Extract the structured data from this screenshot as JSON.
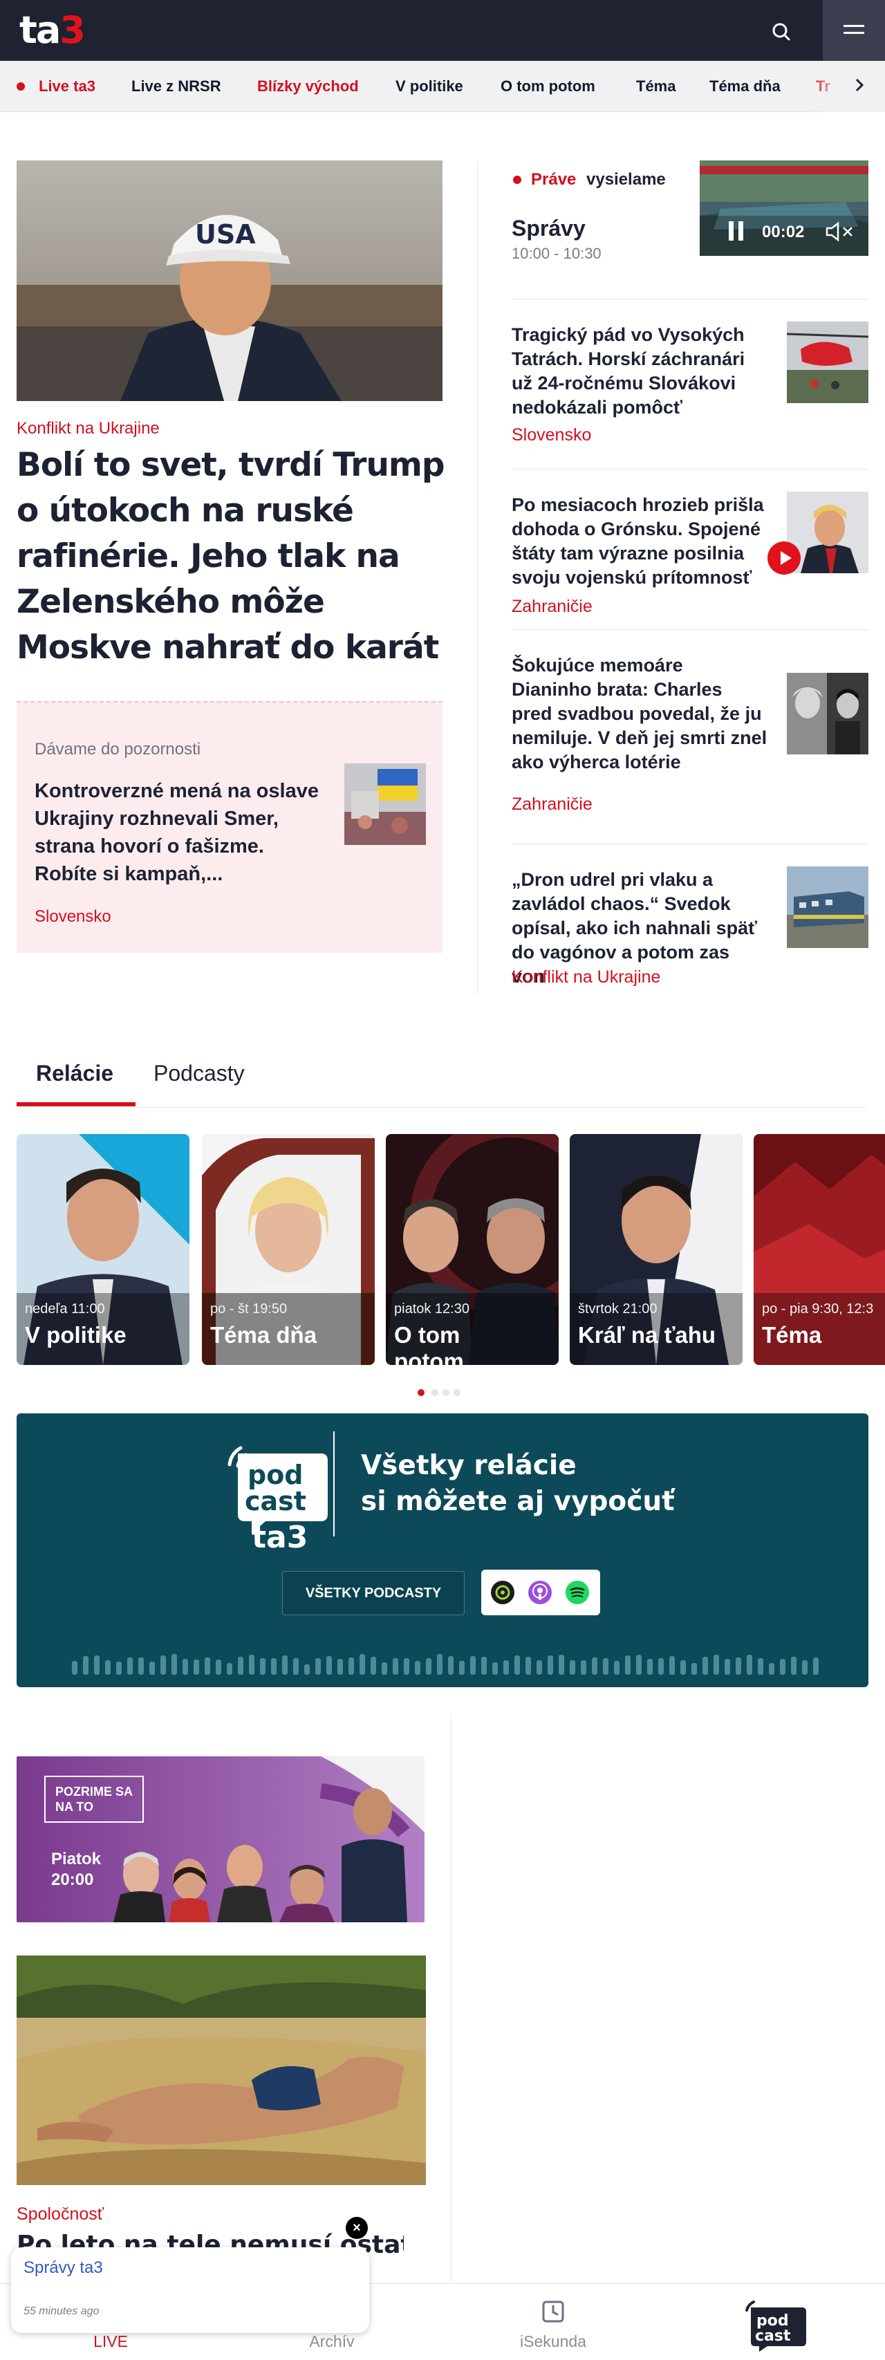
{
  "header": {
    "logo_main": "ta",
    "logo_accent": "3",
    "search_icon": "search-icon",
    "menu_icon": "hamburger-icon"
  },
  "nav": {
    "items": [
      {
        "label": "Live ta3",
        "highlight": true
      },
      {
        "label": "Live z NRSR",
        "highlight": false
      },
      {
        "label": "Blízky východ",
        "highlight": true
      },
      {
        "label": "V politike",
        "highlight": false
      },
      {
        "label": "O tom potom",
        "highlight": false
      },
      {
        "label": "Téma",
        "highlight": false
      },
      {
        "label": "Téma dňa",
        "highlight": false
      },
      {
        "label": "Tr",
        "highlight": true
      }
    ],
    "next_icon": "chevron-right-icon"
  },
  "lead": {
    "tag": "Konflikt na Ukrajine",
    "title": "Bolí to svet, tvrdí Trump o útokoch na ruské rafinérie. Jeho tlak na Zelenského môže Moskve nahrať do karát",
    "cap_text": "USA"
  },
  "attention": {
    "label": "Dávame do pozornosti",
    "title": "Kontroverzné mená na oslave Ukrajiny rozhnevali Smer, strana hovorí o fašizme. Robíte si kampaň,...",
    "tag": "Slovensko"
  },
  "live": {
    "prefix": "Práve",
    "suffix": "vysielame",
    "show": "Správy",
    "time": "10:00 - 10:30",
    "player_time": "00:02"
  },
  "news": [
    {
      "title": "Tragický pád vo Vysokých Tatrách. Horskí záchranári už 24-ročnému Slovákovi nedokázali pomôcť",
      "tag": "Slovensko"
    },
    {
      "title": "Po mesiacoch hrozieb prišla dohoda o Grónsku. Spojené štáty tam výrazne posilnia svoju vojenskú prítomnosť",
      "tag": "Zahraničie"
    },
    {
      "title": "Šokujúce memoáre Dianinho brata: Charles pred svadbou povedal, že ju nemiluje. V deň jej smrti znel ako výherca lotérie",
      "tag": "Zahraničie"
    },
    {
      "title": "„Dron udrel pri vlaku a zavládol chaos.“ Svedok opísal, ako ich nahnali späť do vagónov a potom zas von",
      "tag": "Konflikt na Ukrajine"
    }
  ],
  "tabs": [
    "Relácie",
    "Podcasty"
  ],
  "shows": [
    {
      "schedule": "nedeľa 11:00",
      "name": "V politike"
    },
    {
      "schedule": "po - št 19:50",
      "name": "Téma dňa"
    },
    {
      "schedule": "piatok 12:30",
      "name": "O tom",
      "name2": "potom"
    },
    {
      "schedule": "štvrtok 21:00",
      "name": "Kráľ na ťahu"
    },
    {
      "schedule": "po - pia 9:30, 12:3",
      "name": "Téma"
    }
  ],
  "podcast": {
    "logo_line1": "pod",
    "logo_line2": "cast",
    "logo_line3": "ta3",
    "text_line1": "Všetky relácie",
    "text_line2": "si môžete aj vypočuť",
    "button": "VŠETKY PODCASTY",
    "apps": [
      "podcast-app-icon",
      "apple-podcasts-icon",
      "spotify-icon"
    ]
  },
  "promo": {
    "badge_line1": "POZRIME SA",
    "badge_line2": "NA TO",
    "when_line1": "Piatok",
    "when_line2": "20:00"
  },
  "lower": {
    "tag": "Spoločnosť",
    "title": "Po leto na tele nemusí ostať len"
  },
  "notification": {
    "title": "Správy ta3",
    "time_ago": "55 minutes ago",
    "close": "×"
  },
  "bottom_nav": [
    {
      "label": "LIVE",
      "icon": "broadcast-icon",
      "active": true
    },
    {
      "label": "Archív",
      "icon": "archive-icon",
      "active": false
    },
    {
      "label": "iSekunda",
      "icon": "clock-icon",
      "active": false
    }
  ],
  "bottom_logo": {
    "line1": "pod",
    "line2": "cast"
  },
  "colors": {
    "accent": "#d3101d",
    "header_bg": "#1f2230",
    "podcast_bg": "#0d4a59"
  }
}
